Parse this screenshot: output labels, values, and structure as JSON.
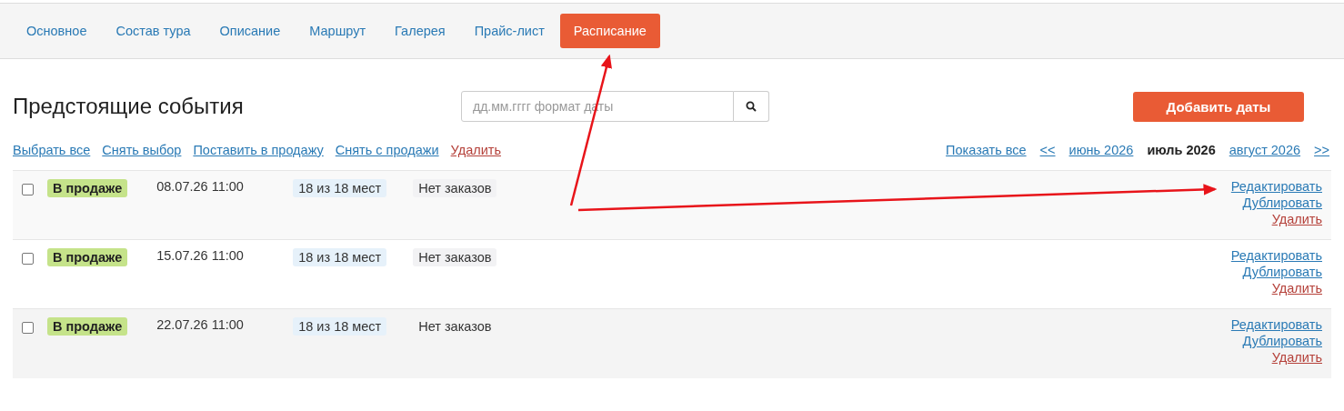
{
  "tabs": [
    {
      "label": "Основное",
      "selected": false
    },
    {
      "label": "Состав тура",
      "selected": false
    },
    {
      "label": "Описание",
      "selected": false
    },
    {
      "label": "Маршрут",
      "selected": false
    },
    {
      "label": "Галерея",
      "selected": false
    },
    {
      "label": "Прайс-лист",
      "selected": false
    },
    {
      "label": "Расписание",
      "selected": true
    }
  ],
  "heading": "Предстоящие события",
  "search": {
    "placeholder": "дд.мм.гггг формат даты"
  },
  "add_button": "Добавить даты",
  "bulk_actions": [
    {
      "label": "Выбрать все",
      "kind": "link"
    },
    {
      "label": "Снять выбор",
      "kind": "link"
    },
    {
      "label": "Поставить в продажу",
      "kind": "link"
    },
    {
      "label": "Снять с продажи",
      "kind": "link"
    },
    {
      "label": "Удалить",
      "kind": "danger"
    }
  ],
  "month_nav": [
    {
      "label": "Показать все",
      "selected": false
    },
    {
      "label": "<<",
      "selected": false
    },
    {
      "label": "июнь 2026",
      "selected": false
    },
    {
      "label": "июль 2026",
      "selected": true
    },
    {
      "label": "август 2026",
      "selected": false
    },
    {
      "label": ">>",
      "selected": false
    }
  ],
  "events": [
    {
      "checked": false,
      "status": "В продаже",
      "datetime": "08.07.26 11:00",
      "seats": "18 из 18 мест",
      "orders": "Нет заказов",
      "actions": [
        {
          "label": "Редактировать",
          "kind": "link"
        },
        {
          "label": "Дублировать",
          "kind": "link"
        },
        {
          "label": "Удалить",
          "kind": "danger"
        }
      ]
    },
    {
      "checked": false,
      "status": "В продаже",
      "datetime": "15.07.26 11:00",
      "seats": "18 из 18 мест",
      "orders": "Нет заказов",
      "actions": [
        {
          "label": "Редактировать",
          "kind": "link"
        },
        {
          "label": "Дублировать",
          "kind": "link"
        },
        {
          "label": "Удалить",
          "kind": "danger"
        }
      ]
    },
    {
      "checked": false,
      "status": "В продаже",
      "datetime": "22.07.26 11:00",
      "seats": "18 из 18 мест",
      "orders": "Нет заказов",
      "actions": [
        {
          "label": "Редактировать",
          "kind": "link"
        },
        {
          "label": "Дублировать",
          "kind": "link"
        },
        {
          "label": "Удалить",
          "kind": "danger"
        }
      ]
    }
  ]
}
